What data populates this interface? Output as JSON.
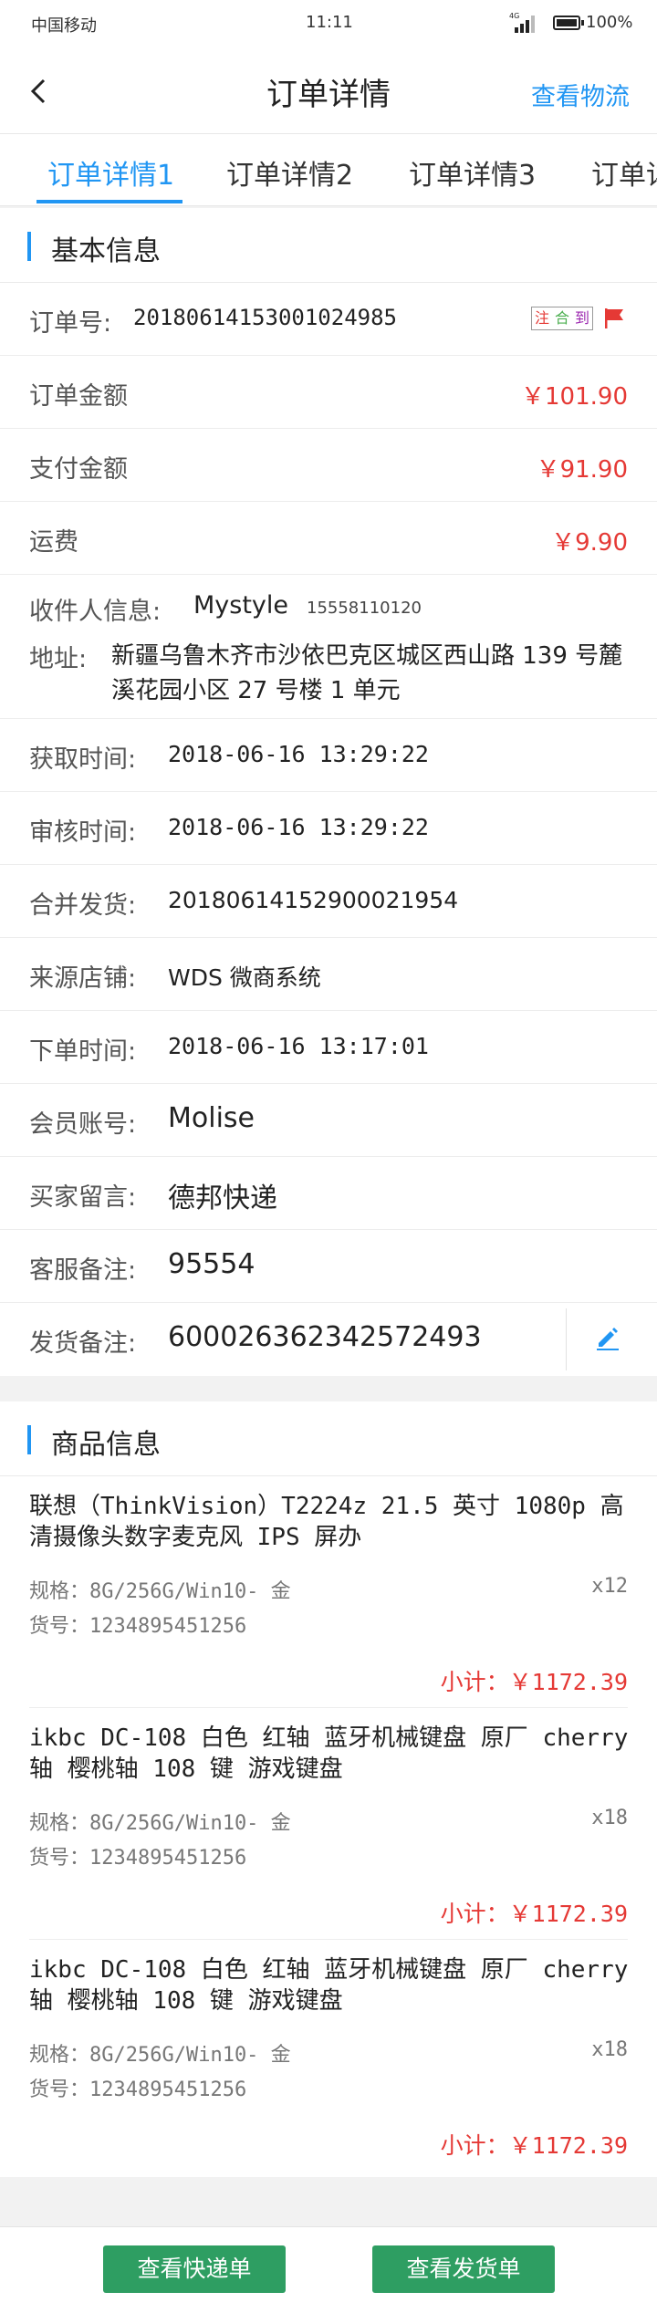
{
  "status_bar": {
    "carrier": "中国移动",
    "time": "11:11",
    "network": "4G",
    "battery": "100%"
  },
  "header": {
    "title": "订单详情",
    "right_action": "查看物流",
    "back_icon": "chevron-left-icon"
  },
  "tabs": [
    {
      "label": "订单详情1",
      "active": true
    },
    {
      "label": "订单详情2",
      "active": false
    },
    {
      "label": "订单详情3",
      "active": false
    },
    {
      "label": "订单详",
      "active": false
    }
  ],
  "basic_info": {
    "section_title": "基本信息",
    "order_no_label": "订单号:",
    "order_no": "20180614153001024985",
    "tags": [
      "注",
      "合",
      "到"
    ],
    "order_amount_label": "订单金额",
    "order_amount": "￥101.90",
    "paid_amount_label": "支付金额",
    "paid_amount": "￥91.90",
    "shipping_label": "运费",
    "shipping": "￥9.90",
    "receiver_label": "收件人信息:",
    "receiver_name": "Mystyle",
    "receiver_phone": "15558110120",
    "address_label": "地址:",
    "address": "新疆乌鲁木齐市沙依巴克区城区西山路 139 号麓溪花园小区 27 号楼 1 单元",
    "fetch_time_label": "获取时间:",
    "fetch_time": "2018-06-16 13:29:22",
    "audit_time_label": "审核时间:",
    "audit_time": "2018-06-16 13:29:22",
    "merge_ship_label": "合并发货:",
    "merge_ship": "20180614152900021954",
    "source_store_label": "来源店铺:",
    "source_store": "WDS 微商系统",
    "order_time_label": "下单时间:",
    "order_time": "2018-06-16 13:17:01",
    "member_label": "会员账号:",
    "member": "Molise",
    "buyer_note_label": "买家留言:",
    "buyer_note": "德邦快递",
    "service_note_label": "客服备注:",
    "service_note": "95554",
    "ship_note_label": "发货备注:",
    "ship_note": "600026362342572493"
  },
  "product_info": {
    "section_title": "商品信息",
    "items": [
      {
        "name": "联想（ThinkVision）T2224z 21.5 英寸 1080p 高清摄像头数字麦克风 IPS 屏办",
        "spec": "规格：8G/256G/Win10- 金",
        "sku": "货号：1234895451256",
        "qty": "x12",
        "subtotal": "小计：￥1172.39"
      },
      {
        "name": "ikbc DC-108 白色 红轴 蓝牙机械键盘 原厂 cherry 轴 樱桃轴 108 键 游戏键盘",
        "spec": "规格：8G/256G/Win10- 金",
        "sku": "货号：1234895451256",
        "qty": "x18",
        "subtotal": "小计：￥1172.39"
      },
      {
        "name": "ikbc DC-108 白色 红轴 蓝牙机械键盘 原厂 cherry 轴 樱桃轴 108 键 游戏键盘",
        "spec": "规格：8G/256G/Win10- 金",
        "sku": "货号：1234895451256",
        "qty": "x18",
        "subtotal": "小计：￥1172.39"
      }
    ]
  },
  "footer": {
    "btn_express": "查看快递单",
    "btn_delivery": "查看发货单"
  },
  "colors": {
    "accent": "#2196f3",
    "price": "#e53935",
    "button": "#2e9e62"
  }
}
